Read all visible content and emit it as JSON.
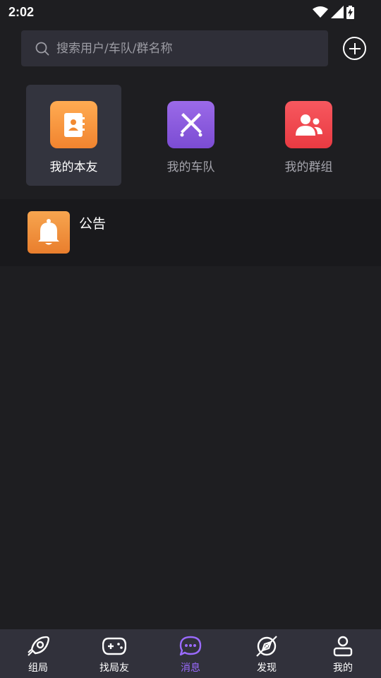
{
  "status_bar": {
    "time": "2:02",
    "icons": [
      "wifi-icon",
      "cellular-signal-icon",
      "battery-charging-icon"
    ]
  },
  "search": {
    "placeholder": "搜索用户/车队/群名称",
    "icon": "search-icon"
  },
  "add_button": {
    "icon": "plus-circle-icon"
  },
  "categories": [
    {
      "label": "我的本友",
      "icon": "contact-book-icon",
      "color": "#f79a3c",
      "selected": true
    },
    {
      "label": "我的车队",
      "icon": "crossed-swords-icon",
      "color": "#8a5ae0",
      "selected": false
    },
    {
      "label": "我的群组",
      "icon": "group-users-icon",
      "color": "#f2484f",
      "selected": false
    }
  ],
  "notice": {
    "title": "公告",
    "icon": "bell-icon",
    "color": "#ef8e3b"
  },
  "bottom_nav": [
    {
      "label": "组局",
      "icon": "rocket-icon",
      "active": false
    },
    {
      "label": "找局友",
      "icon": "gamepad-icon",
      "active": false
    },
    {
      "label": "消息",
      "icon": "chat-bubble-icon",
      "active": true
    },
    {
      "label": "发现",
      "icon": "compass-icon",
      "active": false
    },
    {
      "label": "我的",
      "icon": "user-profile-icon",
      "active": false
    }
  ],
  "colors": {
    "background": "#1e1e21",
    "accent": "#9b6bff",
    "nav_background": "#31313b"
  }
}
